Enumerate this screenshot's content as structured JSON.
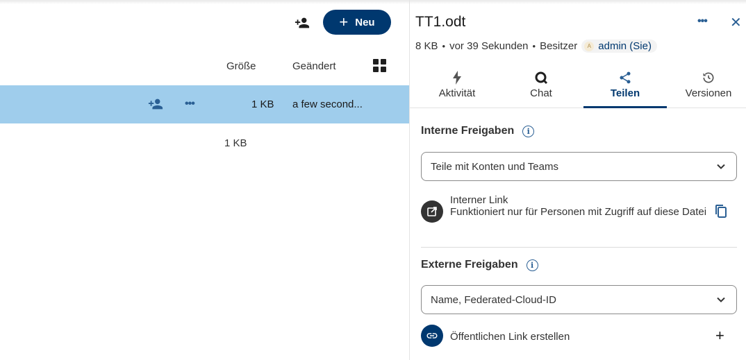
{
  "files": {
    "new_button_label": "Neu",
    "columns": {
      "size": "Größe",
      "modified": "Geändert"
    },
    "selected_row": {
      "size": "1 KB",
      "modified": "a few second...",
      "menu_glyph": "•••"
    },
    "summary_size": "1 KB",
    "icons": [
      "share-add-icon",
      "grid-view-icon",
      "more-icon"
    ]
  },
  "sidebar": {
    "file_name": "TT1.odt",
    "menu_glyph": "•••",
    "close_glyph": "✕",
    "meta": {
      "size": "8 KB",
      "time": "vor 39 Sekunden",
      "owner_label": "Besitzer",
      "owner_avatar": "A",
      "owner_name": "admin (Sie)"
    },
    "tabs": [
      {
        "label": "Aktivität",
        "icon": "lightning-icon"
      },
      {
        "label": "Chat",
        "icon": "chat-icon"
      },
      {
        "label": "Teilen",
        "icon": "share-icon",
        "active": true
      },
      {
        "label": "Versionen",
        "icon": "history-icon"
      }
    ],
    "internal": {
      "heading": "Interne Freigaben",
      "select_placeholder": "Teile mit Konten und Teams",
      "link_title": "Interner Link",
      "link_desc": "Funktioniert nur für Personen mit Zugriff auf diese Datei"
    },
    "external": {
      "heading": "Externe Freigaben",
      "select_placeholder": "Name, Federated-Cloud-ID",
      "public_link_label": "Öffentlichen Link erstellen",
      "add_glyph": "+"
    }
  },
  "colors": {
    "primary": "#00386f",
    "selection": "#9fcdec",
    "icon_blue": "#2a5f94"
  }
}
